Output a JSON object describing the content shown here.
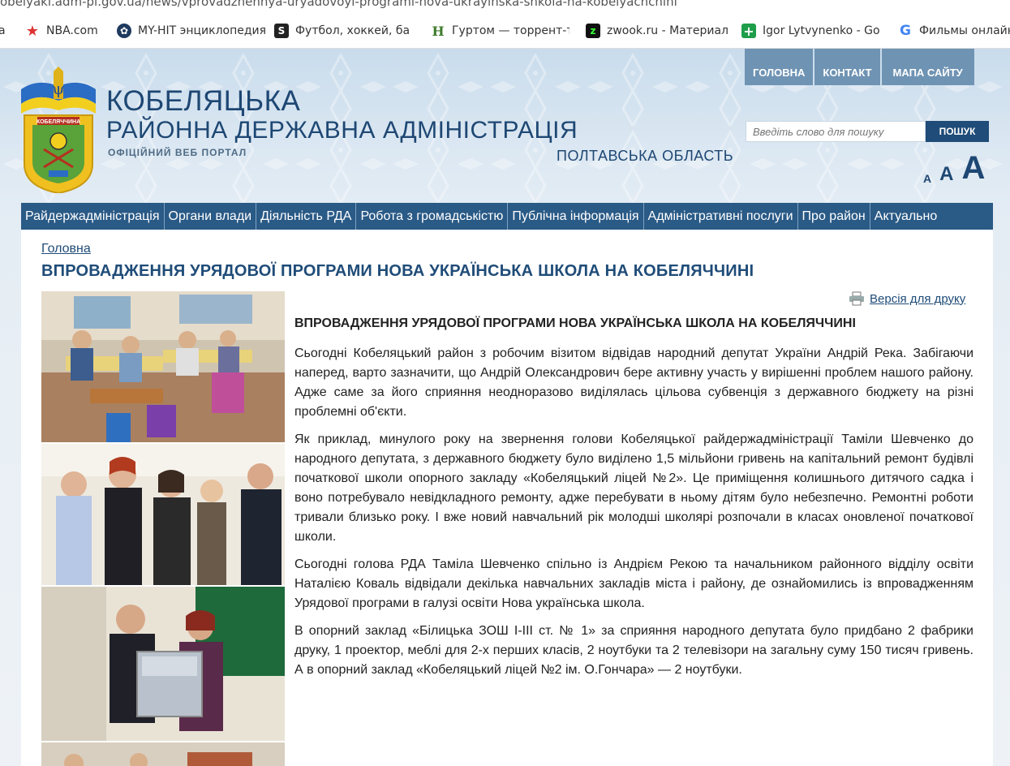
{
  "browser": {
    "url": "obelyaki.adm-pl.gov.ua/news/vprovadzhennya-uryadovoyi-programi-nova-ukrayinska-shkola-na-kobelyachchini",
    "bookmarks": [
      {
        "label": "NBA.com",
        "icon": "star-icon",
        "color": "#e23d3d"
      },
      {
        "label": "MY-HIT энциклопедия",
        "icon": "film-reel-icon",
        "color": "#1e3a5f"
      },
      {
        "label": "Футбол, хоккей, баскетбол",
        "icon": "sports-s-icon",
        "color": "#222222"
      },
      {
        "label": "Гуртом — торрент-т...",
        "icon": "gurtom-h-icon",
        "color": "#3d7a2a"
      },
      {
        "label": "zwook.ru - Материал",
        "icon": "zwook-z-icon",
        "color": "#111111"
      },
      {
        "label": "Igor Lytvynenko - Go",
        "icon": "plus-icon",
        "color": "#1e9e4a"
      },
      {
        "label": "Фильмы онлайн",
        "icon": "google-g-icon",
        "color": "#4285f4"
      }
    ]
  },
  "header": {
    "title_line1": "КОБЕЛЯЦЬКА",
    "title_line2": "РАЙОННА ДЕРЖАВНА АДМІНІСТРАЦІЯ",
    "subtitle": "ОФІЦІЙНИЙ ВЕБ ПОРТАЛ",
    "region": "ПОЛТАВСЬКА ОБЛАСТЬ",
    "logo_text": "КОБЕЛЯЧЧИНА",
    "top_nav": [
      "ГОЛОВНА",
      "КОНТАКТ",
      "МАПА САЙТУ"
    ],
    "search_placeholder": "Введіть слово для пошуку",
    "search_button": "ПОШУК",
    "font_sizes": [
      "A",
      "A",
      "A"
    ]
  },
  "main_nav": [
    "Райдержадміністрація",
    "Органи влади",
    "Діяльність РДА",
    "Робота з громадськістю",
    "Публічна інформація",
    "Адміністративні послуги",
    "Про район",
    "Актуально"
  ],
  "page": {
    "breadcrumb": "Головна",
    "title": "ВПРОВАДЖЕННЯ УРЯДОВОЇ ПРОГРАМИ НОВА УКРАЇНСЬКА ШКОЛА НА КОБЕЛЯЧЧИНІ",
    "print_label": "Версія для друку",
    "article_heading": "ВПРОВАДЖЕННЯ УРЯДОВОЇ ПРОГРАМИ НОВА УКРАЇНСЬКА ШКОЛА НА КОБЕЛЯЧЧИНІ",
    "paragraphs": [
      "Сьогодні Кобеляцький район з робочим візитом відвідав народний депутат України Андрій Река. Забігаючи наперед, варто зазначити, що Андрій Олександрович бере активну участь у вирішенні проблем нашого району. Адже саме за його сприяння неодноразово виділялась цільова субвенція з державного бюджету на різні проблемні об'єкти.",
      "Як приклад, минулого року на звернення голови Кобеляцької райдержадміністрації Таміли Шевченко до народного депутата, з державного бюджету було виділено 1,5 мільйони гривень на капітальний ремонт будівлі початкової школи опорного закладу «Кобеляцький ліцей №2». Це приміщення колишнього дитячого садка і воно потребувало невідкладного ремонту, адже перебувати в ньому дітям було небезпечно. Ремонтні роботи тривали близько року. І вже новий навчальний рік молодші школярі розпочали в класах оновленої початкової школи.",
      "Сьогодні голова РДА Таміла Шевченко спільно із Андрієм Рекою та начальником районного відділу освіти Наталією Коваль відвідали декілька навчальних закладів міста і району, де ознайомились із впровадженням Урядової програми в галузі освіти Нова українська школа.",
      "В опорний заклад «Білицька ЗОШ І-ІІІ ст. № 1» за сприяння народного депутата було придбано 2 фабрики друку, 1 проектор, меблі для 2-х перших класів,  2 ноутбуки та 2 телевізори на загальну суму 150 тисяч гривень. А в опорний заклад «Кобеляцький ліцей №2 ім. О.Гончара» — 2 ноутбуки."
    ]
  },
  "colors": {
    "brand_blue": "#1f4c78",
    "nav_blue": "#2a5a86",
    "topnav_blue": "#6f93b3"
  }
}
